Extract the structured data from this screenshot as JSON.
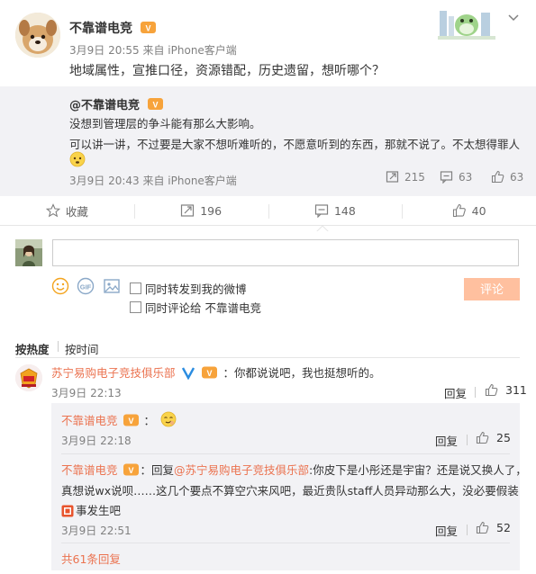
{
  "post": {
    "author": "不靠谱电竞",
    "meta": "3月9日 20:55 来自 iPhone客户端",
    "content": "地域属性，宣推口径，资源错配，历史遗留，想听哪个？"
  },
  "quoted": {
    "author": "@不靠谱电竞",
    "line1": "没想到管理层的争斗能有那么大影响。",
    "line2": "可以讲一讲，不过要是大家不想听难听的，不愿意听到的东西，那就不说了。不太想得罪人",
    "meta": "3月9日 20:43 来自 iPhone客户端",
    "reposts": "215",
    "comments": "63",
    "likes": "63"
  },
  "actions": {
    "favorite": "收藏",
    "repost": "196",
    "comment": "148",
    "like": "40"
  },
  "composer": {
    "placeholder": "",
    "repost_checkbox": "同时转发到我的微博",
    "comment_checkbox": "同时评论给 不靠谱电竞",
    "submit": "评论"
  },
  "sort": {
    "hot": "按热度",
    "time": "按时间"
  },
  "comment1": {
    "name": "苏宁易购电子竞技俱乐部",
    "text": "：你都说说吧，我也挺想听的。",
    "time": "3月9日 22:13",
    "reply": "回复",
    "likes": "311"
  },
  "reply1": {
    "name": "不靠谱电竞",
    "text": "：",
    "time": "3月9日 22:18",
    "reply": "回复",
    "likes": "25"
  },
  "reply2": {
    "name": "不靠谱电竞",
    "prefix": "：回复",
    "mention": "@苏宁易购电子竞技俱乐部",
    "text1": ":你皮下是小彤还是宇宙？还是说又换人了，",
    "text2": "真想说wx说呗……这几个要点不算空穴来风吧，最近贵队staff人员异动那么大，没必要假装",
    "text3": "事发生吧",
    "time": "3月9日 22:51",
    "reply": "回复",
    "likes": "52"
  },
  "more_replies": "共61条回复",
  "colors": {
    "accent": "#eb7350",
    "submit_bg": "#ffc09f",
    "quote_bg": "#f2f2f5",
    "meta_gray": "#808080"
  }
}
